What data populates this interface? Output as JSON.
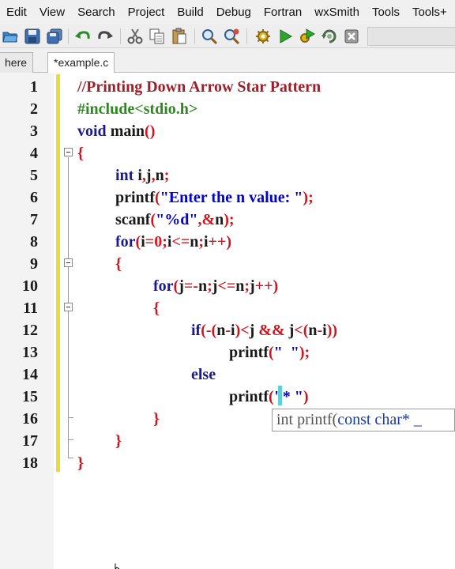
{
  "menu": [
    "Edit",
    "View",
    "Search",
    "Project",
    "Build",
    "Debug",
    "Fortran",
    "wxSmith",
    "Tools",
    "Tools+"
  ],
  "toolbar": {
    "icons": [
      "open-icon",
      "save-icon",
      "save-all-icon",
      "undo-icon",
      "redo-icon",
      "cut-icon",
      "copy-icon",
      "paste-icon",
      "find-icon",
      "replace-icon",
      "build-icon",
      "run-icon",
      "build-and-run-icon",
      "rebuild-icon",
      "abort-icon"
    ]
  },
  "tabs": [
    {
      "label": "here",
      "active": false
    },
    {
      "label": "*example.c",
      "active": true
    }
  ],
  "editor": {
    "lines": [
      {
        "num": "1",
        "segments": [
          {
            "t": "//Printing Down Arrow Star Pattern",
            "c": "c-comment"
          }
        ]
      },
      {
        "num": "2",
        "segments": [
          {
            "t": "#include<stdio.h>",
            "c": "c-pre"
          }
        ]
      },
      {
        "num": "3",
        "segments": [
          {
            "t": "void",
            "c": "c-kw"
          },
          {
            "t": " main",
            "c": "c-fn"
          },
          {
            "t": "()",
            "c": "c-op"
          }
        ]
      },
      {
        "num": "4",
        "segments": [
          {
            "t": "{",
            "c": "c-op"
          }
        ]
      },
      {
        "num": "5",
        "segments": [
          {
            "t": "int",
            "c": "c-kw"
          },
          {
            "t": " i",
            "c": "c-id"
          },
          {
            "t": ",",
            "c": "c-op"
          },
          {
            "t": "j",
            "c": "c-id"
          },
          {
            "t": ",",
            "c": "c-op"
          },
          {
            "t": "n",
            "c": "c-id"
          },
          {
            "t": ";",
            "c": "c-op"
          }
        ]
      },
      {
        "num": "6",
        "segments": [
          {
            "t": "printf",
            "c": "c-fn"
          },
          {
            "t": "(",
            "c": "c-op"
          },
          {
            "t": "\"Enter the n value: \"",
            "c": "c-str"
          },
          {
            "t": ");",
            "c": "c-op"
          }
        ]
      },
      {
        "num": "7",
        "segments": [
          {
            "t": "scanf",
            "c": "c-fn"
          },
          {
            "t": "(",
            "c": "c-op"
          },
          {
            "t": "\"%d\"",
            "c": "c-str"
          },
          {
            "t": ",&",
            "c": "c-op"
          },
          {
            "t": "n",
            "c": "c-id"
          },
          {
            "t": ");",
            "c": "c-op"
          }
        ]
      },
      {
        "num": "8",
        "segments": [
          {
            "t": "for",
            "c": "c-kw"
          },
          {
            "t": "(",
            "c": "c-op"
          },
          {
            "t": "i",
            "c": "c-id"
          },
          {
            "t": "=",
            "c": "c-op"
          },
          {
            "t": "0",
            "c": "c-num"
          },
          {
            "t": ";",
            "c": "c-op"
          },
          {
            "t": "i",
            "c": "c-id"
          },
          {
            "t": "<=",
            "c": "c-op"
          },
          {
            "t": "n",
            "c": "c-id"
          },
          {
            "t": ";",
            "c": "c-op"
          },
          {
            "t": "i",
            "c": "c-id"
          },
          {
            "t": "++)",
            "c": "c-op"
          }
        ]
      },
      {
        "num": "9",
        "segments": [
          {
            "t": "{",
            "c": "c-op"
          }
        ]
      },
      {
        "num": "10",
        "segments": [
          {
            "t": "for",
            "c": "c-kw"
          },
          {
            "t": "(",
            "c": "c-op"
          },
          {
            "t": "j",
            "c": "c-id"
          },
          {
            "t": "=-",
            "c": "c-op"
          },
          {
            "t": "n",
            "c": "c-id"
          },
          {
            "t": ";",
            "c": "c-op"
          },
          {
            "t": "j",
            "c": "c-id"
          },
          {
            "t": "<=",
            "c": "c-op"
          },
          {
            "t": "n",
            "c": "c-id"
          },
          {
            "t": ";",
            "c": "c-op"
          },
          {
            "t": "j",
            "c": "c-id"
          },
          {
            "t": "++)",
            "c": "c-op"
          }
        ]
      },
      {
        "num": "11",
        "segments": [
          {
            "t": "{",
            "c": "c-op"
          }
        ]
      },
      {
        "num": "12",
        "segments": [
          {
            "t": "if",
            "c": "c-kw"
          },
          {
            "t": "(-(",
            "c": "c-op"
          },
          {
            "t": "n",
            "c": "c-id"
          },
          {
            "t": "-",
            "c": "c-op"
          },
          {
            "t": "i",
            "c": "c-id"
          },
          {
            "t": ")<",
            "c": "c-op"
          },
          {
            "t": "j",
            "c": "c-id"
          },
          {
            "t": " && ",
            "c": "c-op"
          },
          {
            "t": "j",
            "c": "c-id"
          },
          {
            "t": "<(",
            "c": "c-op"
          },
          {
            "t": "n",
            "c": "c-id"
          },
          {
            "t": "-",
            "c": "c-op"
          },
          {
            "t": "i",
            "c": "c-id"
          },
          {
            "t": "))",
            "c": "c-op"
          }
        ]
      },
      {
        "num": "13",
        "segments": [
          {
            "t": "printf",
            "c": "c-fn"
          },
          {
            "t": "(",
            "c": "c-op"
          },
          {
            "t": "\"  \"",
            "c": "c-str"
          },
          {
            "t": ");",
            "c": "c-op"
          }
        ]
      },
      {
        "num": "14",
        "segments": [
          {
            "t": "else",
            "c": "c-kw"
          }
        ]
      },
      {
        "num": "15",
        "segments": [
          {
            "t": "printf",
            "c": "c-fn"
          },
          {
            "t": "(",
            "c": "c-op"
          },
          {
            "t": "\"* \"",
            "c": "c-str"
          },
          {
            "t": ")",
            "c": "c-op"
          }
        ]
      },
      {
        "num": "16",
        "segments": [
          {
            "t": "}",
            "c": "c-op"
          }
        ]
      },
      {
        "num": "17",
        "segments": [
          {
            "t": "}",
            "c": "c-op"
          }
        ]
      },
      {
        "num": "18",
        "segments": [
          {
            "t": "}",
            "c": "c-op"
          }
        ]
      }
    ]
  },
  "calltip": {
    "prefix": "int printf(",
    "param": "const char* _"
  }
}
